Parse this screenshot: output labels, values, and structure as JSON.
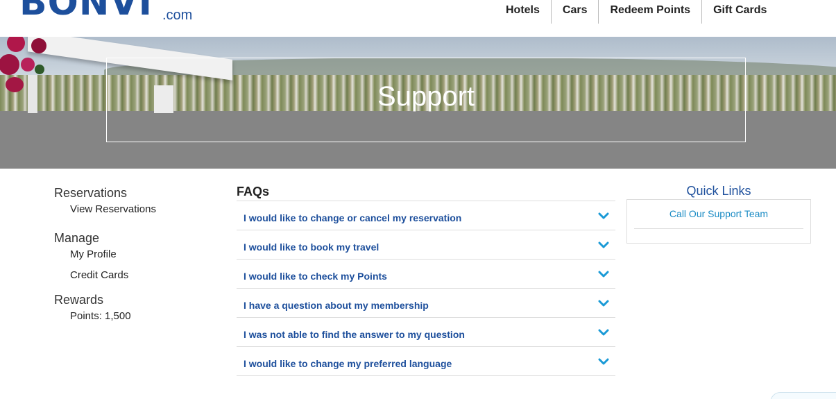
{
  "brand": {
    "logo_text": "BONVI",
    "logo_suffix": ".com",
    "color": "#1d4f9c"
  },
  "nav": {
    "items": [
      "Hotels",
      "Cars",
      "Redeem Points",
      "Gift Cards"
    ]
  },
  "hero": {
    "title": "Support"
  },
  "sidebar": {
    "reservations": {
      "title": "Reservations",
      "links": [
        "View Reservations"
      ]
    },
    "manage": {
      "title": "Manage",
      "links": [
        "My Profile",
        "Credit Cards"
      ]
    },
    "rewards": {
      "title": "Rewards",
      "points": "Points: 1,500"
    }
  },
  "faq": {
    "heading": "FAQs",
    "items": [
      "I would like to change or cancel my reservation",
      "I would like to book my travel",
      "I would like to check my Points",
      "I have a question about my membership",
      "I was not able to find the answer to my question",
      "I would like to change my preferred language"
    ],
    "chevron_color": "#1a9ad6"
  },
  "quick_links": {
    "title": "Quick Links",
    "links": [
      "Call Our Support Team"
    ]
  },
  "icons": {
    "faq_toggle": "chevron-down-icon",
    "chat": "chat-icon"
  }
}
